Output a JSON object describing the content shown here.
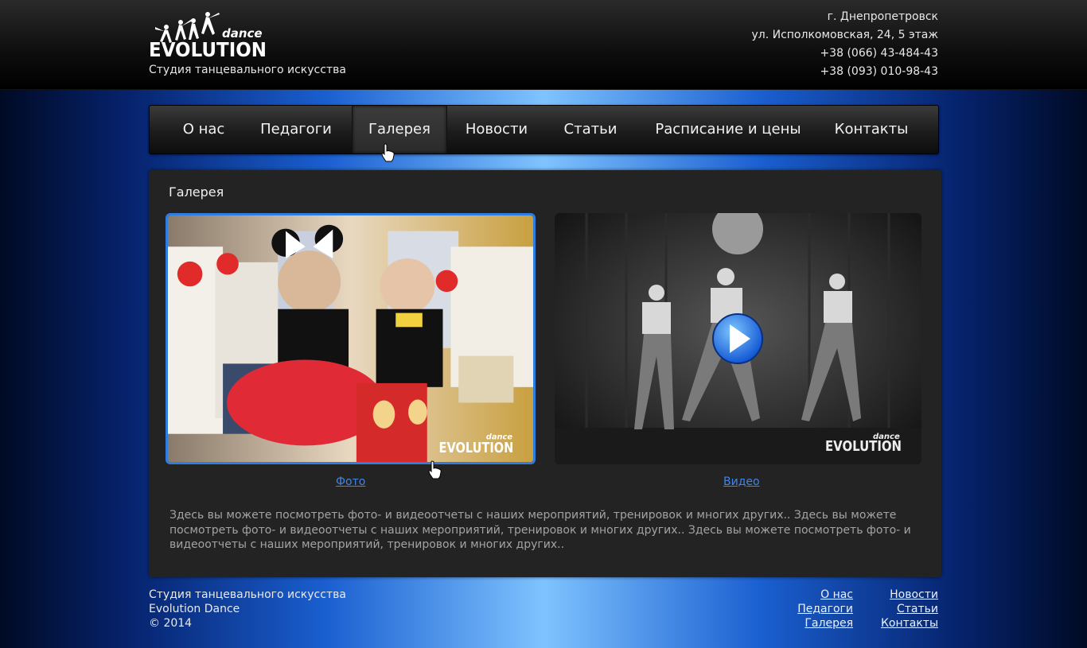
{
  "header": {
    "logo_small": "dance",
    "logo_big": "EVOLUTION",
    "tagline": "Студия танцевального искусства",
    "contacts": [
      "г. Днепропетровск",
      "ул. Исполкомовская, 24, 5 этаж",
      "+38 (066) 43-484-43",
      "+38 (093) 010-98-43"
    ]
  },
  "nav": {
    "items": [
      "О нас",
      "Педагоги",
      "Галерея",
      "Новости",
      "Статьи",
      "Расписание и цены",
      "Контакты"
    ],
    "active": "Галерея"
  },
  "gallery": {
    "title": "Галерея",
    "photo_link": "Фото",
    "video_link": "Видео",
    "watermark_small": "dance",
    "watermark_big": "EVOLUTION",
    "description": "Здесь вы можете посмотреть фото- и видеоотчеты с наших мероприятий, тренировок и многих других.. Здесь вы можете посмотреть фото- и видеоотчеты с наших мероприятий, тренировок и многих других.. Здесь вы можете посмотреть фото- и видеоотчеты с наших мероприятий, тренировок и многих других.."
  },
  "footer": {
    "lines": [
      "Студия танцевального искусства",
      "Evolution Dance",
      "© 2014"
    ],
    "col1": [
      "О нас",
      "Педагоги",
      "Галерея"
    ],
    "col2": [
      "Новости",
      "Статьи",
      "Контакты"
    ]
  },
  "colors": {
    "accent_blue": "#2f7de0",
    "link_blue": "#3f86e6",
    "panel_bg": "#232323"
  },
  "icons": {
    "play": "play-icon",
    "cursor": "hand-pointer-icon"
  }
}
